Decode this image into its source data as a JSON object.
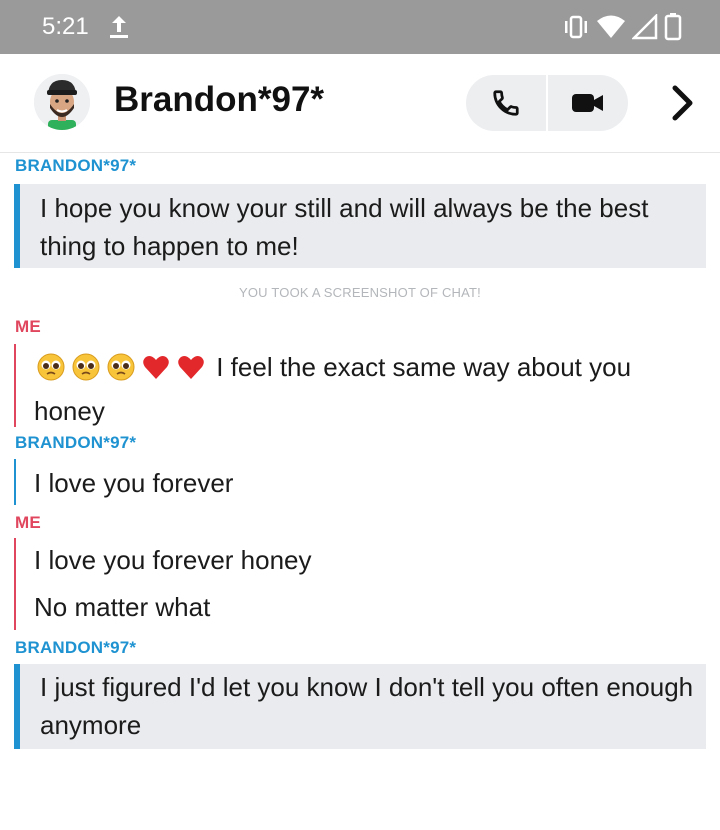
{
  "status_bar": {
    "time": "5:21",
    "icons": [
      "upload-icon",
      "vibrate-icon",
      "wifi-icon",
      "signal-icon",
      "battery-icon"
    ]
  },
  "header": {
    "contact_name": "Brandon*97*",
    "icons": [
      "avatar",
      "phone-icon",
      "video-icon",
      "chevron-right-icon"
    ]
  },
  "chat": {
    "sender_them": "BRANDON*97*",
    "sender_me": "ME",
    "screenshot_notice": "YOU TOOK A SCREENSHOT OF CHAT!",
    "messages": [
      {
        "from": "BRANDON*97*",
        "text": "I hope you know your still and will always be the best thing to happen to me!"
      },
      {
        "from": "ME",
        "emoji": [
          "pleading-face",
          "pleading-face",
          "pleading-face",
          "red-heart",
          "red-heart"
        ],
        "text": "I feel the exact same way about you honey"
      },
      {
        "from": "BRANDON*97*",
        "text": "I love you forever"
      },
      {
        "from": "ME",
        "text": "I love you forever honey"
      },
      {
        "from": "ME",
        "text": "No matter what"
      },
      {
        "from": "BRANDON*97*",
        "text": "I just figured I'd let you know I don't tell you often enough anymore"
      }
    ]
  },
  "colors": {
    "them_accent": "#1f93d1",
    "me_accent": "#e0465e",
    "status_bar_bg": "#9a9a9a",
    "highlight_bg": "#e9ebee"
  }
}
